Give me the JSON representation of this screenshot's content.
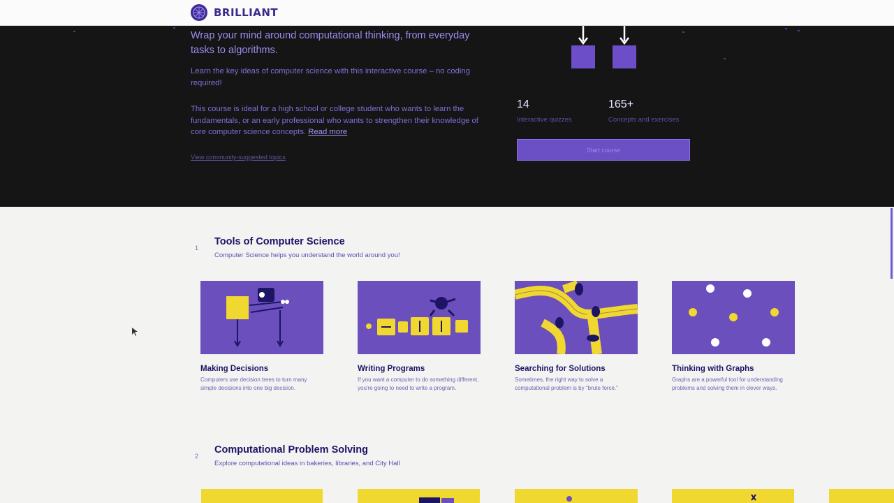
{
  "brand": {
    "name": "BRILLIANT"
  },
  "hero": {
    "tagline": "Wrap your mind around computational thinking, from everyday tasks to algorithms.",
    "paragraph1": "Learn the key ideas of computer science with this interactive course – no coding required!",
    "paragraph2": "This course is ideal for a high school or college student who wants to learn the fundamentals, or an early professional who wants to strengthen their knowledge of core computer science concepts.",
    "read_more": "Read more",
    "link": "View community-suggested topics",
    "stats": [
      {
        "value": "14",
        "label": "Interactive quizzes"
      },
      {
        "value": "165+",
        "label": "Concepts and exercises"
      }
    ],
    "cta": "Start course"
  },
  "sections": [
    {
      "number": "1",
      "title": "Tools of Computer Science",
      "subtitle": "Computer Science helps you understand the world around you!",
      "cards": [
        {
          "title": "Making Decisions",
          "description": "Computers use decision trees to turn many simple decisions into one big decision."
        },
        {
          "title": "Writing Programs",
          "description": "If you want a computer to do something different, you're going to need to write a program."
        },
        {
          "title": "Searching for Solutions",
          "description": "Sometimes, the right way to solve a computational problem is by \"brute force.\""
        },
        {
          "title": "Thinking with Graphs",
          "description": "Graphs are a powerful tool for understanding problems and solving them in clever ways."
        }
      ]
    },
    {
      "number": "2",
      "title": "Computational Problem Solving",
      "subtitle": "Explore computational ideas in bakeries, libraries, and City Hall"
    }
  ],
  "colors": {
    "accent": "#6b4fc5",
    "card_bg": "#6b4fbd",
    "yellow": "#f1d831",
    "hero_bg": "#151515"
  }
}
